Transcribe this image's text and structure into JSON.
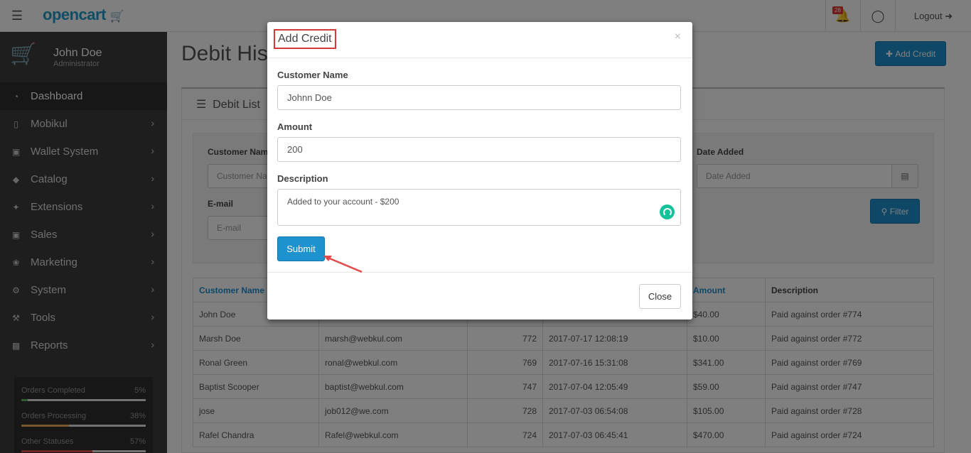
{
  "header": {
    "logo": "opencart",
    "notifications_count": "28",
    "logout_label": "Logout"
  },
  "sidebar": {
    "user_name": "John Doe",
    "user_role": "Administrator",
    "items": [
      {
        "label": "Dashboard",
        "icon": "dashboard-icon"
      },
      {
        "label": "Mobikul",
        "icon": "mobile-icon"
      },
      {
        "label": "Wallet System",
        "icon": "credit-card-icon"
      },
      {
        "label": "Catalog",
        "icon": "tags-icon"
      },
      {
        "label": "Extensions",
        "icon": "puzzle-icon"
      },
      {
        "label": "Sales",
        "icon": "shopping-cart-icon"
      },
      {
        "label": "Marketing",
        "icon": "share-icon"
      },
      {
        "label": "System",
        "icon": "cog-icon"
      },
      {
        "label": "Tools",
        "icon": "wrench-icon"
      },
      {
        "label": "Reports",
        "icon": "bar-chart-icon"
      }
    ],
    "stats": [
      {
        "label": "Orders Completed",
        "value": "5%",
        "percent": 5,
        "color": "#5cb85c"
      },
      {
        "label": "Orders Processing",
        "value": "38%",
        "percent": 38,
        "color": "#f0ad4e"
      },
      {
        "label": "Other Statuses",
        "value": "57%",
        "percent": 57,
        "color": "#d9534f"
      }
    ]
  },
  "page": {
    "title": "Debit History",
    "add_credit_label": "Add Credit",
    "panel_title": "Debit List",
    "filter": {
      "customer_label": "Customer Name",
      "customer_placeholder": "Customer Name",
      "email_label": "E-mail",
      "email_placeholder": "E-mail",
      "date_label": "Date Added",
      "date_placeholder": "Date Added",
      "filter_button": "Filter"
    },
    "table": {
      "headers": [
        "Customer Name",
        "",
        "",
        "",
        "Amount",
        "Description"
      ],
      "rows": [
        [
          "John Doe",
          "",
          "",
          "",
          "$40.00",
          "Paid against order #774"
        ],
        [
          "Marsh Doe",
          "marsh@webkul.com",
          "772",
          "2017-07-17 12:08:19",
          "$10.00",
          "Paid against order #772"
        ],
        [
          "Ronal Green",
          "ronal@webkul.com",
          "769",
          "2017-07-16 15:31:08",
          "$341.00",
          "Paid against order #769"
        ],
        [
          "Baptist Scooper",
          "baptist@webkul.com",
          "747",
          "2017-07-04 12:05:49",
          "$59.00",
          "Paid against order #747"
        ],
        [
          "jose",
          "job012@we.com",
          "728",
          "2017-07-03 06:54:08",
          "$105.00",
          "Paid against order #728"
        ],
        [
          "Rafel Chandra",
          "Rafel@webkul.com",
          "724",
          "2017-07-03 06:45:41",
          "$470.00",
          "Paid against order #724"
        ]
      ]
    }
  },
  "modal": {
    "title": "Add Credit",
    "close_x": "×",
    "customer_label": "Customer Name",
    "customer_value": "Johnn Doe",
    "amount_label": "Amount",
    "amount_value": "200",
    "description_label": "Description",
    "description_value": "Added to your account - $200",
    "submit_label": "Submit",
    "close_label": "Close"
  },
  "colors": {
    "accent": "#1e91cf",
    "sidebar_bg": "#3d3d3d",
    "highlight": "#d9383a"
  }
}
